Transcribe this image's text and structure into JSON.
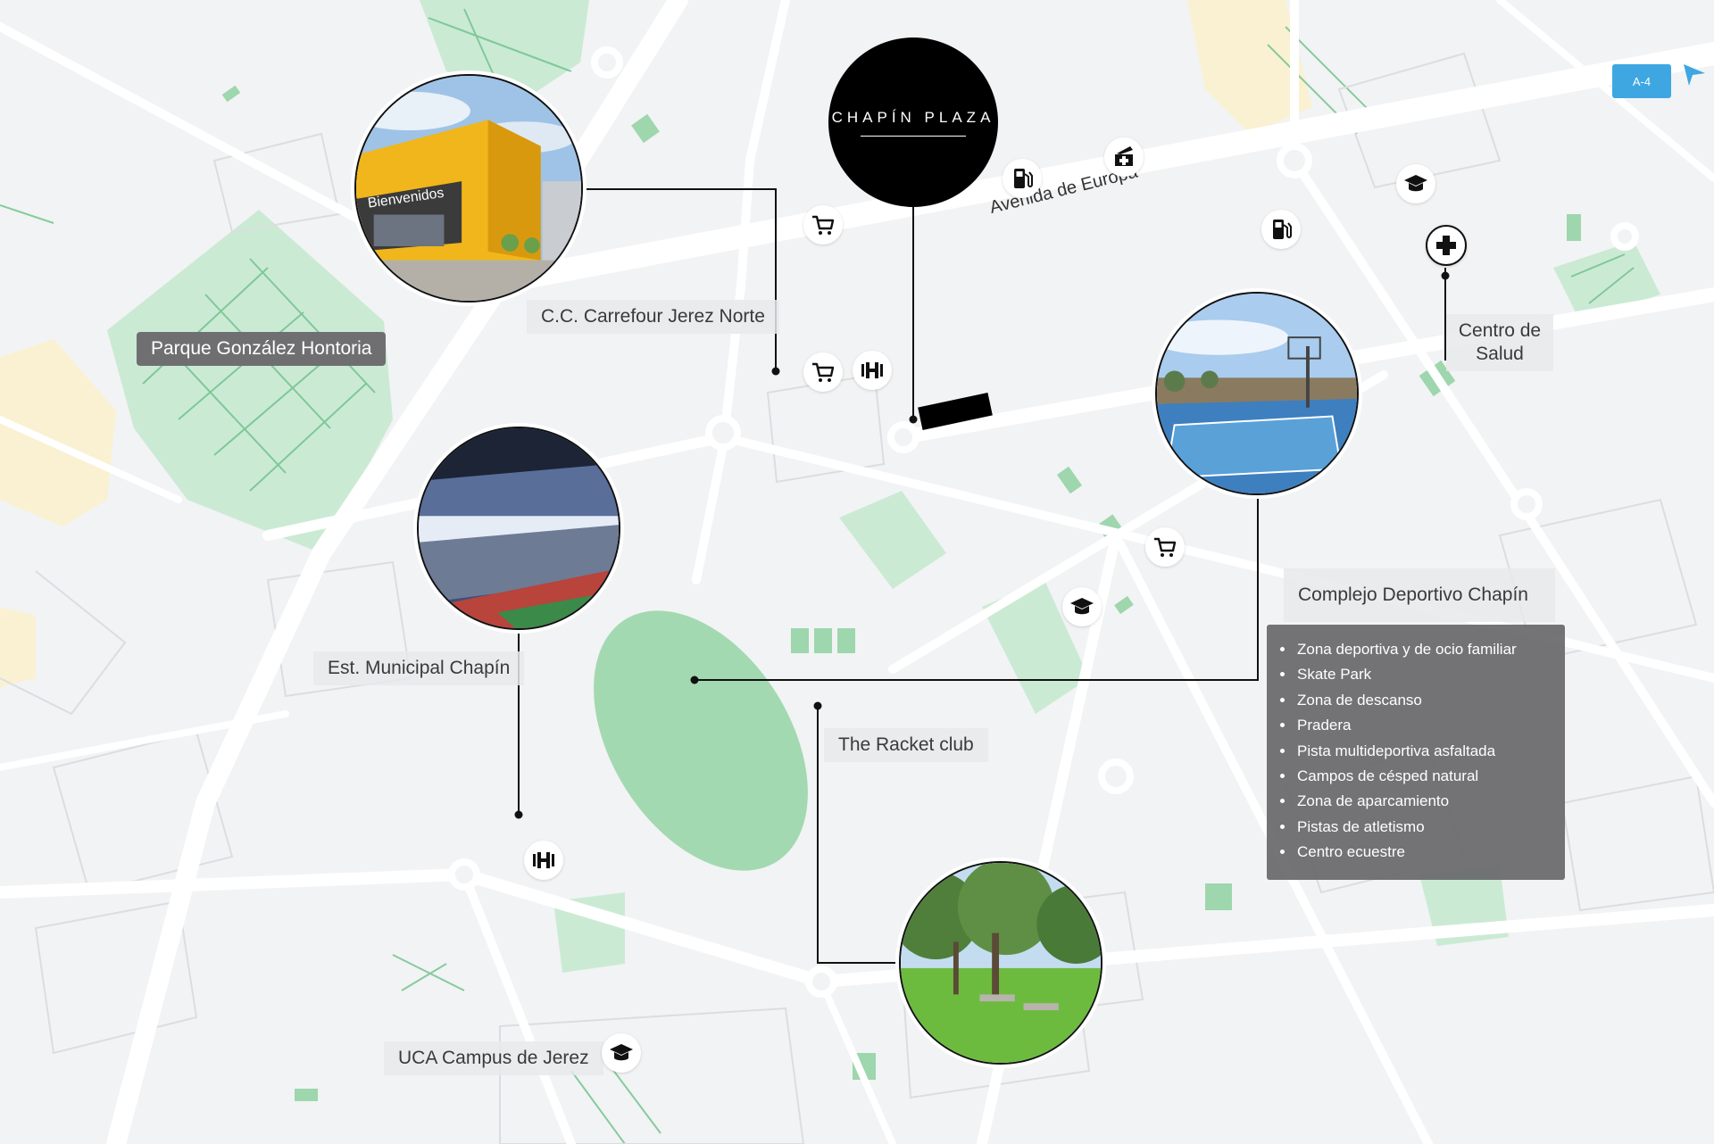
{
  "brand": {
    "name": "CHAPÍN PLAZA"
  },
  "road": {
    "name": "Avenida de Europa"
  },
  "highway": {
    "label": "A-4",
    "color": "#3ea7e2"
  },
  "places": {
    "carrefour": "C.C. Carrefour Jerez Norte",
    "parque": "Parque González Hontoria",
    "estadio": "Est. Municipal Chapín",
    "racket": "The Racket club",
    "uca": "UCA Campus de Jerez",
    "centro_salud": "Centro de Salud",
    "complejo": "Complejo Deportivo Chapín"
  },
  "photo_signage": {
    "store_sign": "Bienvenidos"
  },
  "complejo_features": [
    "Zona deportiva y de ocio familiar",
    "Skate Park",
    "Zona de descanso",
    "Pradera",
    "Pista multideportiva asfaltada",
    "Campos de césped natural",
    "Zona de aparcamiento",
    "Pistas de atletismo",
    "Centro ecuestre"
  ],
  "poi_icons": [
    "shopping-cart-icon",
    "fuel-station-icon",
    "pharmacy-icon",
    "education-cap-icon",
    "gym-dumbbell-icon",
    "hospital-cross-icon"
  ],
  "colors": {
    "park_green": "#bfe5c9",
    "park_line": "#6cc08a",
    "road": "#ffffff",
    "land": "#f2f3f4",
    "label_dark": "#6f6f71"
  }
}
